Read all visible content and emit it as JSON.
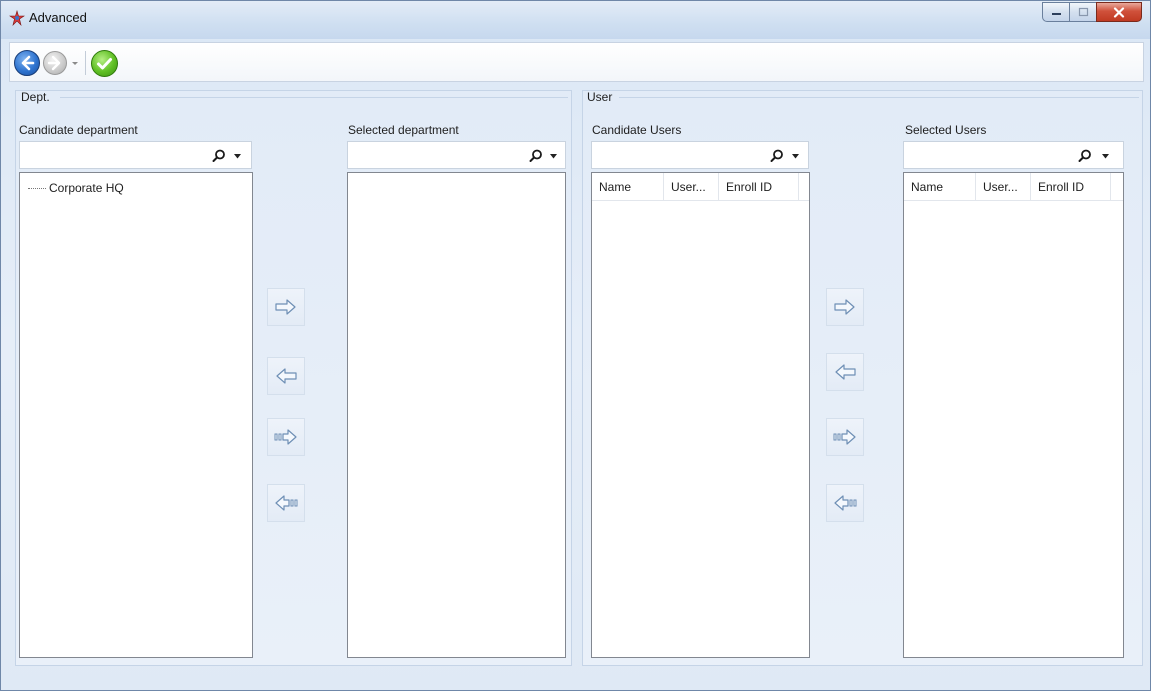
{
  "window": {
    "title": "Advanced",
    "controls": [
      "minimize",
      "maximize",
      "close"
    ]
  },
  "toolbar": {
    "items": [
      "back",
      "forward",
      "forward-dropdown",
      "confirm"
    ]
  },
  "dept": {
    "group_title": "Dept.",
    "candidate_label": "Candidate department",
    "candidate_search_value": "",
    "candidate_items": [
      {
        "label": "Corporate HQ"
      }
    ],
    "selected_label": "Selected department",
    "selected_search_value": "",
    "selected_items": []
  },
  "user": {
    "group_title": "User",
    "candidate_label": "Candidate Users",
    "candidate_search_value": "",
    "selected_label": "Selected Users",
    "selected_search_value": "",
    "columns": [
      "Name",
      "User...",
      "Enroll ID"
    ],
    "candidate_rows": [],
    "selected_rows": []
  },
  "transfer_buttons": [
    "move-selected-right",
    "move-selected-left",
    "move-all-right",
    "move-all-left"
  ],
  "colors": {
    "window_bg": "#dfe9f5",
    "border": "#828790",
    "accent_blue": "#2f74d0",
    "confirm_green": "#5fbf24",
    "arrow": "#6e8fb5"
  }
}
